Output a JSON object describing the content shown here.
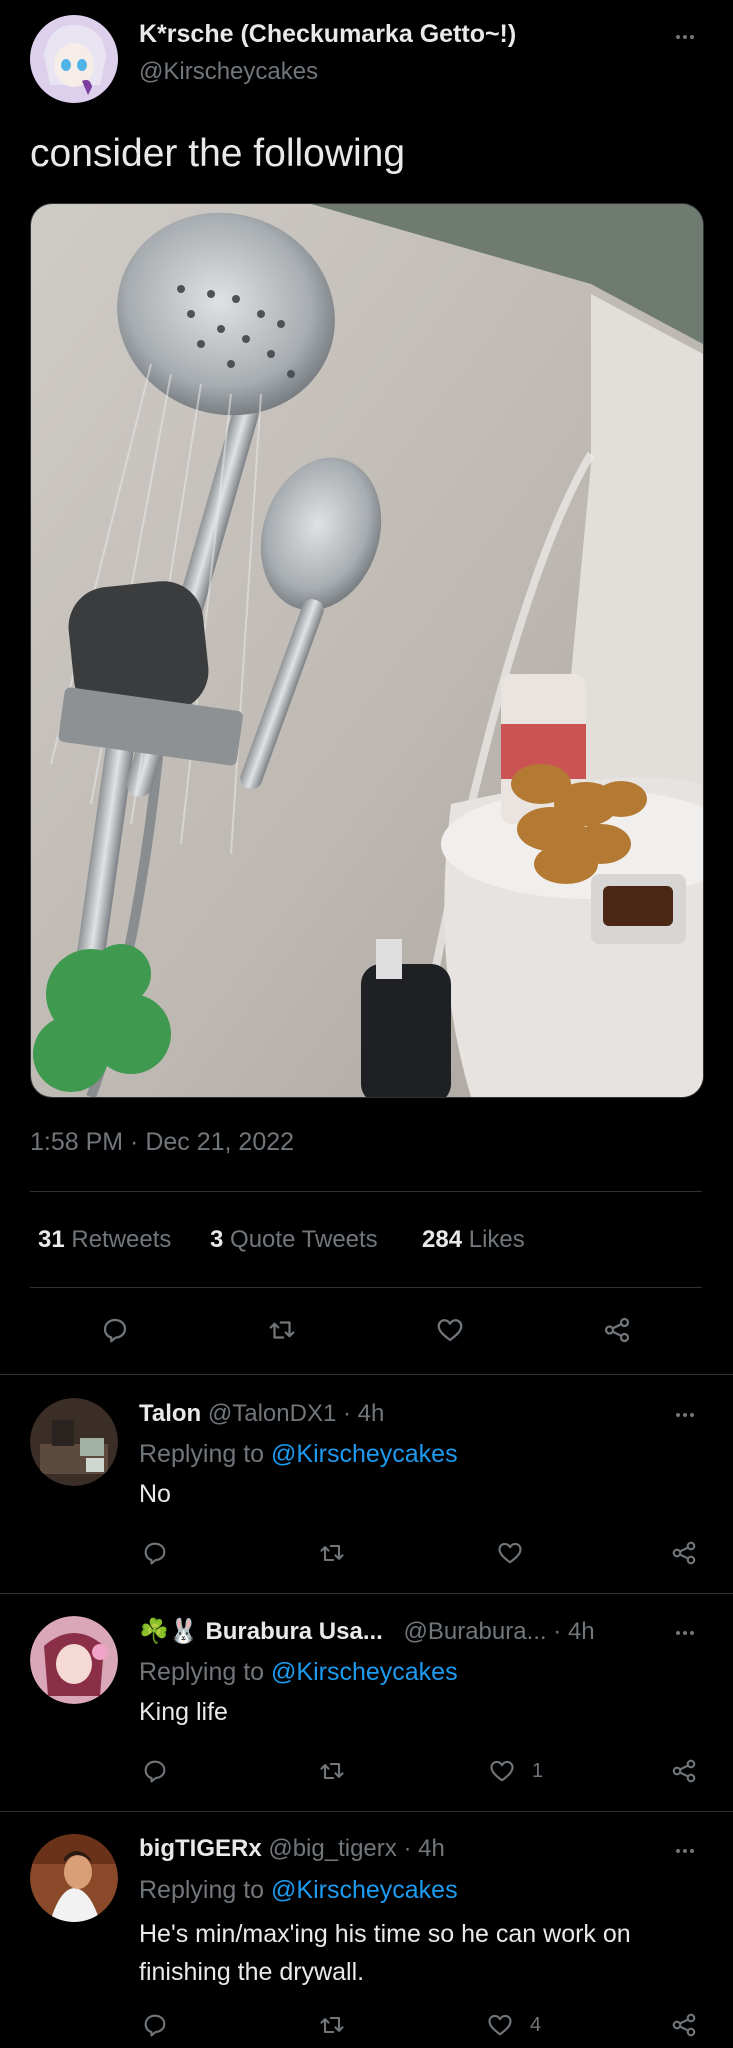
{
  "tweet": {
    "author_name": "K*rsche (Checkumarka Getto~!)",
    "author_handle": "@Kirscheycakes",
    "text": "consider the following",
    "timestamp": "1:58 PM · Dec 21, 2022",
    "stats": [
      {
        "count": "31",
        "label": "Retweets"
      },
      {
        "count": "3",
        "label": "Quote Tweets"
      },
      {
        "count": "284",
        "label": "Likes"
      }
    ]
  },
  "replies": [
    {
      "name": "Talon",
      "handle": "@TalonDX1",
      "time": "· 4h",
      "replying_prefix": "Replying to",
      "replying_to": "@Kirscheycakes",
      "text": "No",
      "likes": ""
    },
    {
      "name": "Burabura Usa...",
      "handle": "@Burabura...",
      "time": "· 4h",
      "replying_prefix": "Replying to",
      "replying_to": "@Kirscheycakes",
      "text": "King life",
      "likes": "1",
      "emoji": "☘️🐰"
    },
    {
      "name": "bigTIGERx",
      "handle": "@big_tigerx",
      "time": "· 4h",
      "replying_prefix": "Replying to",
      "replying_to": "@Kirscheycakes",
      "text": "He's min/max'ing his time so he can work on finishing the drywall.",
      "likes": "4"
    }
  ],
  "colors": {
    "background": "#000000",
    "text": "#e7e9ea",
    "muted": "#71767b",
    "link": "#1d9bf0",
    "divider": "#2f3336"
  }
}
